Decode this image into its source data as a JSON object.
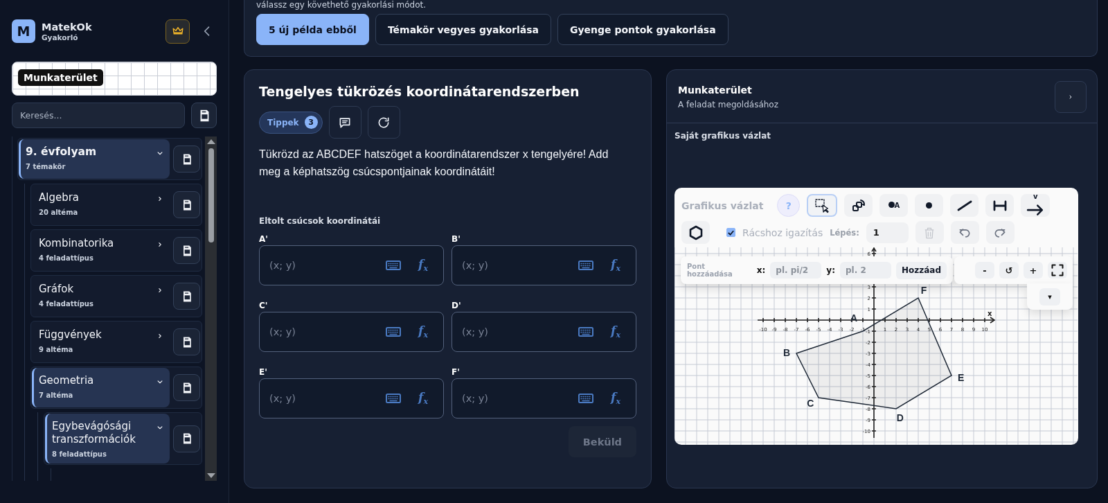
{
  "sidebar": {
    "logo_letter": "M",
    "app_name": "MatekOk",
    "app_subtitle": "Gyakorló",
    "workspace_preview": "Munkaterület",
    "search": {
      "placeholder": "Keresés..."
    },
    "tree": [
      {
        "title": "9. évfolyam",
        "subtitle": "7 témakör",
        "expanded": true,
        "children": [
          {
            "title": "Algebra",
            "subtitle": "20 altéma",
            "expanded": false
          },
          {
            "title": "Kombinatorika",
            "subtitle": "4 feladattípus",
            "expanded": false
          },
          {
            "title": "Gráfok",
            "subtitle": "4 feladattípus",
            "expanded": false
          },
          {
            "title": "Függvények",
            "subtitle": "9 altéma",
            "expanded": false
          },
          {
            "title": "Geometria",
            "subtitle": "7 altéma",
            "expanded": true,
            "children": [
              {
                "title": "Egybevágósági transzformációk",
                "subtitle": "8 feladattípus",
                "expanded": true
              }
            ]
          }
        ]
      }
    ]
  },
  "practice_modes": {
    "prompt": "válassz egy követhető gyakorlási módot.",
    "buttons": [
      {
        "label": "5 új példa ebből",
        "selected": true
      },
      {
        "label": "Témakör vegyes gyakorlása",
        "selected": false
      },
      {
        "label": "Gyenge pontok gyakorlása",
        "selected": false
      }
    ]
  },
  "problem": {
    "title": "Tengelyes tükrözés koordinátarendszerben",
    "hints": {
      "label": "Tippek",
      "count": "3"
    },
    "text": "Tükrözd az ABCDEF hatszöget a koordinátarendszer x tengelyére! Add meg a képhatszög csúcspontjainak koordinátáit!",
    "answer_title": "Eltolt csúcsok koordinátái",
    "fields": [
      {
        "label": "A'",
        "placeholder": "(x; y)",
        "formula_button": "f$_{x}$"
      },
      {
        "label": "B'",
        "placeholder": "(x; y)",
        "formula_button": "f$_{x}$"
      },
      {
        "label": "C'",
        "placeholder": "(x; y)",
        "formula_button": "f$_{x}$"
      },
      {
        "label": "D'",
        "placeholder": "(x; y)",
        "formula_button": "f$_{x}$"
      },
      {
        "label": "E'",
        "placeholder": "(x; y)",
        "formula_button": "f$_{x}$"
      },
      {
        "label": "F'",
        "placeholder": "(x; y)",
        "formula_button": "f$_{x}$"
      }
    ],
    "submit": {
      "label": "Beküld",
      "disabled": true
    }
  },
  "workspace": {
    "title": "Munkaterület",
    "subtitle": "A feladat megoldásához",
    "section_title": "Saját grafikus vázlat",
    "sketch": {
      "title": "Grafikus vázlat",
      "help": "?",
      "tools": [
        {
          "kind": "select",
          "selected": true
        },
        {
          "kind": "transform",
          "selected": false
        },
        {
          "kind": "labeled-point",
          "label": "A",
          "selected": false
        },
        {
          "kind": "point",
          "selected": false
        },
        {
          "kind": "line",
          "selected": false
        },
        {
          "kind": "segment",
          "selected": false
        },
        {
          "kind": "vector",
          "label": "v",
          "selected": false
        }
      ],
      "shape_tool": {
        "kind": "polygon"
      },
      "snap": {
        "label": "Rácshoz igazítás",
        "checked": true
      },
      "step": {
        "label": "Lépés:",
        "value": "1"
      },
      "actions": [
        {
          "kind": "delete",
          "disabled": true
        },
        {
          "kind": "undo",
          "disabled": false
        },
        {
          "kind": "redo",
          "disabled": false
        }
      ],
      "add_point": {
        "title": "Pont hozzáadása",
        "x_label": "x:",
        "x_placeholder": "pl. pi/2",
        "y_label": "y:",
        "y_placeholder": "pl. 2",
        "button": "Hozzáad"
      },
      "zoom_controls": [
        {
          "kind": "minus",
          "label": "-"
        },
        {
          "kind": "reset",
          "label": "↺"
        },
        {
          "kind": "plus",
          "label": "+"
        },
        {
          "kind": "fullscreen"
        }
      ],
      "dropdown": "▾",
      "chart_data": {
        "type": "area",
        "grid": true,
        "xlabel": "x",
        "x": [
          -1,
          -7,
          -5,
          2,
          7,
          4
        ],
        "series": [
          {
            "color": "#1f2937",
            "values": [
              -1,
              -3,
              -7,
              -8,
              -5,
              2
            ]
          }
        ],
        "xlim": [
          -10,
          10
        ],
        "ylim": [
          -10,
          6
        ],
        "xticks": [
          -10,
          -9,
          -8,
          -7,
          -6,
          -5,
          -4,
          -3,
          -2,
          -1,
          1,
          2,
          3,
          4,
          5,
          6,
          7,
          8,
          9,
          10
        ],
        "yticks": [
          -10,
          -9,
          -8,
          -7,
          -6,
          -5,
          -4,
          -3,
          -2,
          -1,
          1,
          2,
          3,
          6
        ],
        "annotations": [
          "A",
          "B",
          "C",
          "D",
          "E",
          "F"
        ]
      }
    }
  }
}
